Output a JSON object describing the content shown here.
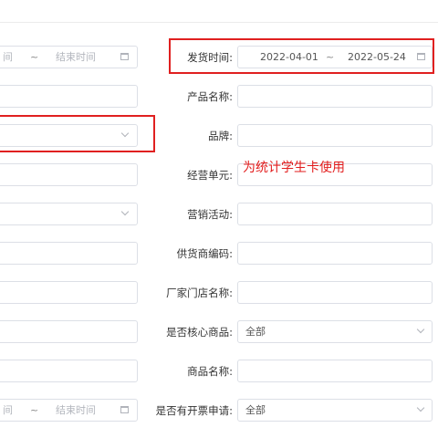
{
  "form": {
    "left_range": {
      "start_placeholder": "间",
      "separator": "~",
      "end_placeholder": "结束时间"
    },
    "left_range_bottom": {
      "start_placeholder": "间",
      "separator": "~",
      "end_placeholder": "结束时间"
    },
    "right_fields": [
      {
        "label": "发货时间:",
        "type": "daterange",
        "start": "2022-04-01",
        "separator": "~",
        "end": "2022-05-24"
      },
      {
        "label": "产品名称:",
        "type": "text",
        "value": ""
      },
      {
        "label": "品牌:",
        "type": "text",
        "value": ""
      },
      {
        "label": "经营单元:",
        "type": "text",
        "value": ""
      },
      {
        "label": "营销活动:",
        "type": "text",
        "value": ""
      },
      {
        "label": "供货商编码:",
        "type": "text",
        "value": ""
      },
      {
        "label": "厂家门店名称:",
        "type": "text",
        "value": ""
      },
      {
        "label": "是否核心商品:",
        "type": "select",
        "value": "全部"
      },
      {
        "label": "商品名称:",
        "type": "text",
        "value": ""
      },
      {
        "label": "是否有开票申请:",
        "type": "select",
        "value": "全部"
      }
    ]
  },
  "annotation": {
    "text": "为统计学生卡使用",
    "color": "#e21d1d"
  },
  "highlight_color": "#e02020"
}
